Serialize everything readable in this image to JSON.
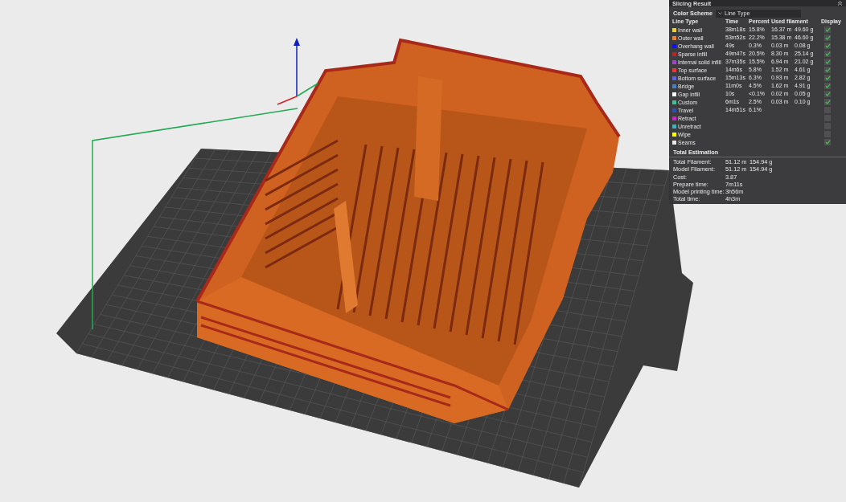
{
  "panel": {
    "title": "Slicing Result",
    "color_scheme": {
      "label": "Color Scheme",
      "value": "Line Type"
    },
    "columns": [
      "Line Type",
      "Time",
      "Percent",
      "Used filament",
      "Display"
    ],
    "line_types": [
      {
        "name": "Inner wall",
        "color": "#f0d030",
        "time": "38m18s",
        "percent": "15.8%",
        "length": "16.37 m",
        "weight": "49.60 g",
        "displayed": true
      },
      {
        "name": "Outer wall",
        "color": "#f08030",
        "time": "53m52s",
        "percent": "22.2%",
        "length": "15.38 m",
        "weight": "46.60 g",
        "displayed": true
      },
      {
        "name": "Overhang wall",
        "color": "#1010f0",
        "time": "49s",
        "percent": "0.3%",
        "length": "0.03 m",
        "weight": "0.08 g",
        "displayed": true
      },
      {
        "name": "Sparse infill",
        "color": "#b02828",
        "time": "49m47s",
        "percent": "20.5%",
        "length": "8.30 m",
        "weight": "25.14 g",
        "displayed": true
      },
      {
        "name": "Internal solid infill",
        "color": "#9848c8",
        "time": "37m35s",
        "percent": "15.5%",
        "length": "6.94 m",
        "weight": "21.02 g",
        "displayed": true
      },
      {
        "name": "Top surface",
        "color": "#e83838",
        "time": "14m6s",
        "percent": "5.8%",
        "length": "1.52 m",
        "weight": "4.61 g",
        "displayed": true
      },
      {
        "name": "Bottom surface",
        "color": "#6060e0",
        "time": "15m13s",
        "percent": "6.3%",
        "length": "0.93 m",
        "weight": "2.82 g",
        "displayed": true
      },
      {
        "name": "Bridge",
        "color": "#4880c0",
        "time": "11m0s",
        "percent": "4.5%",
        "length": "1.62 m",
        "weight": "4.91 g",
        "displayed": true
      },
      {
        "name": "Gap infill",
        "color": "#ffffff",
        "time": "10s",
        "percent": "<0.1%",
        "length": "0.02 m",
        "weight": "0.05 g",
        "displayed": true
      },
      {
        "name": "Custom",
        "color": "#40c090",
        "time": "6m1s",
        "percent": "2.5%",
        "length": "0.03 m",
        "weight": "0.10 g",
        "displayed": true
      },
      {
        "name": "Travel",
        "color": "#3050b0",
        "time": "14m51s",
        "percent": "6.1%",
        "displayed": false
      },
      {
        "name": "Retract",
        "color": "#c828c8",
        "displayed": false
      },
      {
        "name": "Unretract",
        "color": "#40b0c0",
        "displayed": false
      },
      {
        "name": "Wipe",
        "color": "#ffff00",
        "displayed": false
      },
      {
        "name": "Seams",
        "color": "#e8e8e8",
        "displayed": true
      }
    ],
    "total_estimation": {
      "title": "Total Estimation",
      "rows": [
        {
          "label": "Total Filament:",
          "value": "51.12 m",
          "weight": "154.94 g"
        },
        {
          "label": "Model Filament:",
          "value": "51.12 m",
          "weight": "154.94 g"
        },
        {
          "label": "Cost:",
          "value": "3.87"
        },
        {
          "label": "Prepare time:",
          "value": "7m11s"
        },
        {
          "label": "Model printing time:",
          "value": "3h56m"
        },
        {
          "label": "Total time:",
          "value": "4h3m"
        }
      ]
    }
  }
}
